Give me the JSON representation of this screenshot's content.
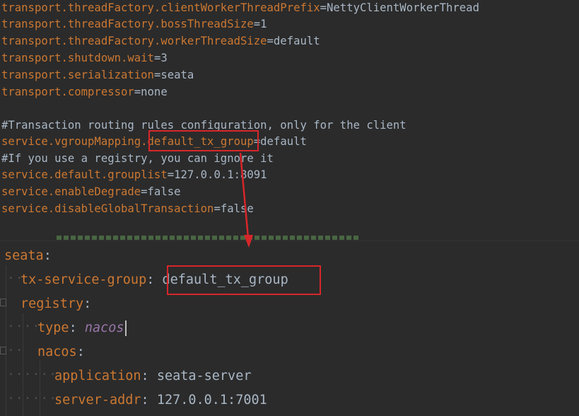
{
  "properties_lines": [
    {
      "key": "transport.threadFactory.clientWorkerThreadPrefix",
      "sep": "=",
      "value": "NettyClientWorkerThread"
    },
    {
      "key": "transport.threadFactory.bossThreadSize",
      "sep": "=",
      "value": "1"
    },
    {
      "key": "transport.threadFactory.workerThreadSize",
      "sep": "=",
      "value": "default"
    },
    {
      "key": "transport.shutdown.wait",
      "sep": "=",
      "value": "3"
    },
    {
      "key": "transport.serialization",
      "sep": "=",
      "value": "seata"
    },
    {
      "key": "transport.compressor",
      "sep": "=",
      "value": "none"
    }
  ],
  "comment1": "#Transaction routing rules configuration, only for the client",
  "vgroup_key_prefix": "service.vgroupMapping.",
  "vgroup_key_highlight": "default_tx_group",
  "vgroup_sep": "=",
  "vgroup_value": "default",
  "comment2": "#If you use a registry, you can ignore it",
  "service_lines": [
    {
      "key": "service.default.grouplist",
      "sep": "=",
      "value": "127.0.0.1:8091"
    },
    {
      "key": "service.enableDegrade",
      "sep": "=",
      "value": "false"
    },
    {
      "key": "service.disableGlobalTransaction",
      "sep": "=",
      "value": "false"
    }
  ],
  "yaml": {
    "seata_key": "seata",
    "tx_service_group_key": "tx-service-group",
    "tx_service_group_value": "default_tx_group",
    "registry_key": "registry",
    "type_key": "type",
    "type_value": "nacos",
    "nacos_key": "nacos",
    "application_key": "application",
    "application_value": "seata-server",
    "server_addr_key": "server-addr",
    "server_addr_value": "127.0.0.1:7001",
    "colon": ":"
  },
  "colors": {
    "background": "#2b2b2b",
    "key": "#cc7832",
    "comment": "#629755",
    "highlight_box": "#d7262a",
    "italic_value": "#9876aa"
  }
}
